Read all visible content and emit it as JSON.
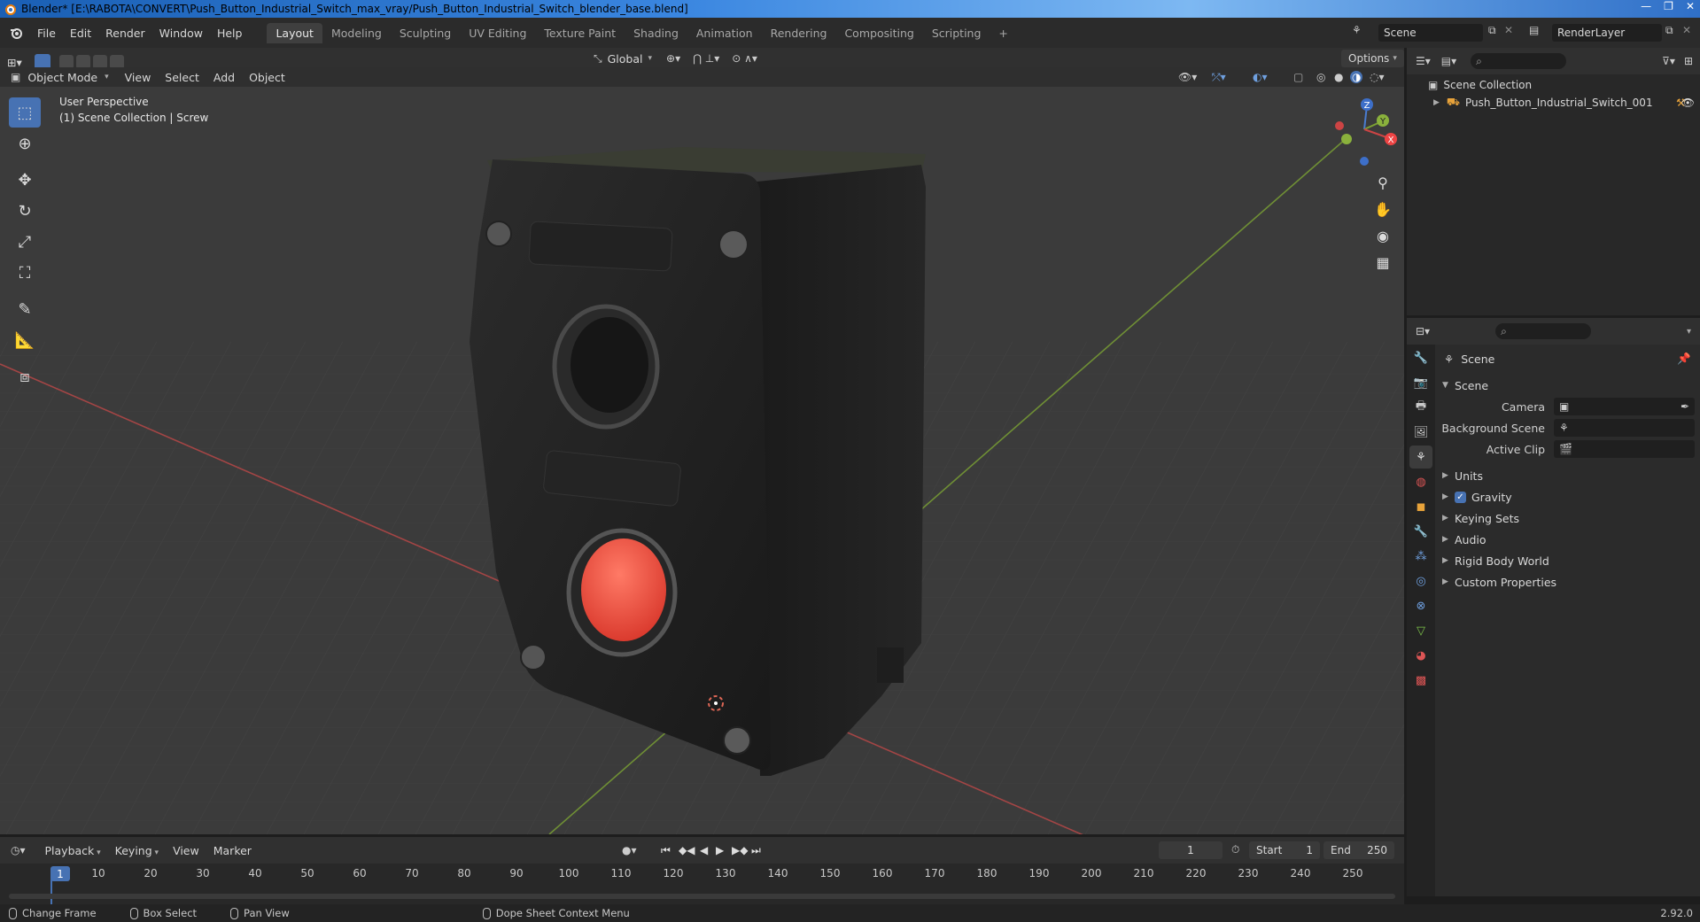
{
  "window": {
    "title": "Blender* [E:\\RABOTA\\CONVERT\\Push_Button_Industrial_Switch_max_vray/Push_Button_Industrial_Switch_blender_base.blend]",
    "controls": [
      "—",
      "❐",
      "✕"
    ]
  },
  "menu": [
    "File",
    "Edit",
    "Render",
    "Window",
    "Help"
  ],
  "workspaces": [
    "Layout",
    "Modeling",
    "Sculpting",
    "UV Editing",
    "Texture Paint",
    "Shading",
    "Animation",
    "Rendering",
    "Compositing",
    "Scripting"
  ],
  "active_workspace": "Layout",
  "add_workspace": "+",
  "scene_field": "Scene",
  "renderlayer_field": "RenderLayer",
  "viewport_header": {
    "mode": "Object Mode",
    "menus": [
      "View",
      "Select",
      "Add",
      "Object"
    ],
    "orientation": "Global",
    "options": "Options"
  },
  "viewport": {
    "perspective": "User Perspective",
    "collection_info": "(1) Scene Collection | Screw",
    "gizmo_axes": [
      "Z",
      "Y",
      "X"
    ]
  },
  "toolbar_icons": [
    "select-box-icon",
    "cursor-icon",
    "move-icon",
    "rotate-icon",
    "scale-icon",
    "transform-icon",
    "annotate-icon",
    "measure-icon",
    "add-cube-icon"
  ],
  "outliner": {
    "root": "Scene Collection",
    "items": [
      "Push_Button_Industrial_Switch_001"
    ]
  },
  "properties": {
    "context": "Scene",
    "panel_title": "Scene",
    "fields": [
      {
        "label": "Camera",
        "value": ""
      },
      {
        "label": "Background Scene",
        "value": ""
      },
      {
        "label": "Active Clip",
        "value": ""
      }
    ],
    "panels": [
      "Units",
      "Gravity",
      "Keying Sets",
      "Audio",
      "Rigid Body World",
      "Custom Properties"
    ],
    "gravity_checked": true
  },
  "timeline": {
    "menus": [
      "Playback",
      "Keying",
      "View",
      "Marker"
    ],
    "current_frame": "1",
    "start_label": "Start",
    "start": "1",
    "end_label": "End",
    "end": "250",
    "ticks": [
      "1",
      "10",
      "20",
      "30",
      "40",
      "50",
      "60",
      "70",
      "80",
      "90",
      "100",
      "110",
      "120",
      "130",
      "140",
      "150",
      "160",
      "170",
      "180",
      "190",
      "200",
      "210",
      "220",
      "230",
      "240",
      "250"
    ]
  },
  "statusbar": {
    "items": [
      "Change Frame",
      "Box Select",
      "Pan View",
      "Dope Sheet Context Menu"
    ],
    "version": "2.92.0"
  },
  "colors": {
    "accent": "#4772b3",
    "viewport_bg": "#3d3d3d",
    "axis_x": "#b44a4a",
    "axis_y": "#7a9a3a",
    "button_red": "#f05a48"
  }
}
